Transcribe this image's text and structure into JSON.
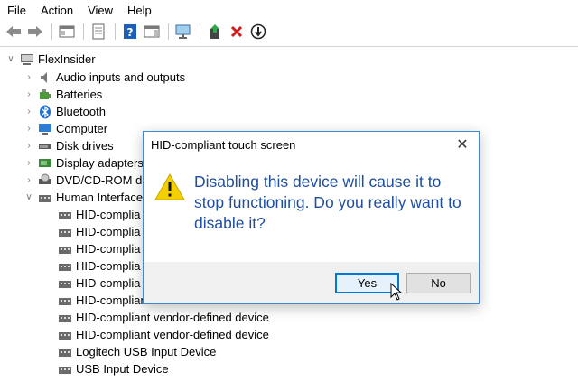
{
  "menu": {
    "items": [
      "File",
      "Action",
      "View",
      "Help"
    ]
  },
  "toolbar": {
    "icons": [
      "back-arrow-icon",
      "forward-arrow-icon",
      "show-hide-console-icon",
      "properties-icon",
      "help-icon",
      "action-pane-icon",
      "scan-hardware-icon",
      "update-driver-icon",
      "uninstall-icon",
      "disable-device-icon"
    ]
  },
  "tree": {
    "root": "FlexInsider",
    "categories": [
      "Audio inputs and outputs",
      "Batteries",
      "Bluetooth",
      "Computer",
      "Disk drives",
      "Display adapters",
      "DVD/CD-ROM d",
      "Human Interface"
    ],
    "hid_children": [
      "HID-complia",
      "HID-complia",
      "HID-complia",
      "HID-complia",
      "HID-complia",
      "HID-compliant vendor-defined device",
      "HID-compliant vendor-defined device",
      "HID-compliant vendor-defined device",
      "Logitech USB Input Device",
      "USB Input Device"
    ]
  },
  "dialog": {
    "title": "HID-compliant touch screen",
    "message": "Disabling this device will cause it to stop functioning. Do you really want to disable it?",
    "yes_label": "Yes",
    "no_label": "No",
    "accent": "#0078d7",
    "message_color": "#1f4ea0"
  }
}
